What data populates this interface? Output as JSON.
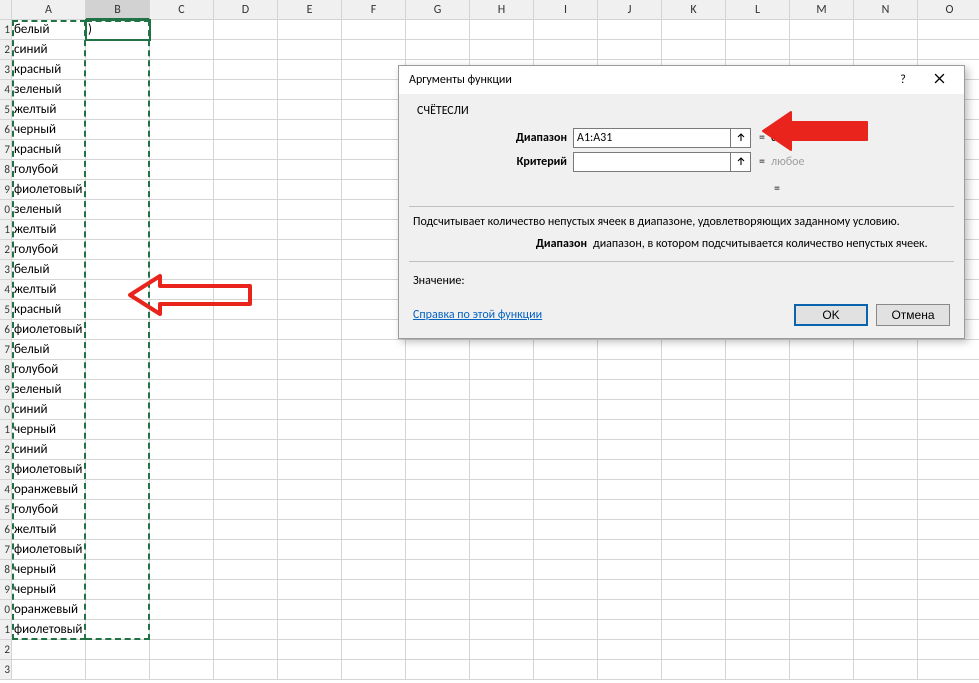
{
  "columns": [
    "A",
    "B",
    "C",
    "D",
    "E",
    "F",
    "G",
    "H",
    "I",
    "J",
    "K",
    "L",
    "M",
    "N",
    "O"
  ],
  "selectedColumn": "B",
  "rows": [
    {
      "n": "1",
      "a": "белый",
      "b": ")"
    },
    {
      "n": "2",
      "a": "синий"
    },
    {
      "n": "3",
      "a": "красный"
    },
    {
      "n": "4",
      "a": "зеленый"
    },
    {
      "n": "5",
      "a": "желтый"
    },
    {
      "n": "6",
      "a": "черный"
    },
    {
      "n": "7",
      "a": "красный"
    },
    {
      "n": "8",
      "a": "голубой"
    },
    {
      "n": "9",
      "a": "фиолетовый"
    },
    {
      "n": "0",
      "a": "зеленый"
    },
    {
      "n": "1",
      "a": "желтый"
    },
    {
      "n": "2",
      "a": "голубой"
    },
    {
      "n": "3",
      "a": "белый"
    },
    {
      "n": "4",
      "a": "желтый"
    },
    {
      "n": "5",
      "a": "красный"
    },
    {
      "n": "6",
      "a": "фиолетовый"
    },
    {
      "n": "7",
      "a": "белый"
    },
    {
      "n": "8",
      "a": "голубой"
    },
    {
      "n": "9",
      "a": "зеленый"
    },
    {
      "n": "0",
      "a": "синий"
    },
    {
      "n": "1",
      "a": "черный"
    },
    {
      "n": "2",
      "a": "синий"
    },
    {
      "n": "3",
      "a": "фиолетовый"
    },
    {
      "n": "4",
      "a": "оранжевый"
    },
    {
      "n": "5",
      "a": "голубой"
    },
    {
      "n": "6",
      "a": "желтый"
    },
    {
      "n": "7",
      "a": "фиолетовый"
    },
    {
      "n": "8",
      "a": "черный"
    },
    {
      "n": "9",
      "a": "черный"
    },
    {
      "n": "0",
      "a": "оранжевый"
    },
    {
      "n": "1",
      "a": "фиолетовый"
    },
    {
      "n": "2",
      "a": ""
    },
    {
      "n": "3",
      "a": ""
    }
  ],
  "dialog": {
    "title": "Аргументы функции",
    "funcName": "СЧЁТЕСЛИ",
    "arg1": {
      "label": "Диапазон",
      "value": "A1:A31",
      "result": "сный\":\"зелен..."
    },
    "arg2": {
      "label": "Критерий",
      "value": "",
      "result": "любое"
    },
    "eq": "=",
    "eqResult": "=",
    "desc": "Подсчитывает количество непустых ячеек в диапазоне, удовлетворяющих заданному условию.",
    "argDescLabel": "Диапазон",
    "argDescText": "диапазон, в котором подсчитывается количество непустых ячеек.",
    "valueLabel": "Значение:",
    "helpLink": "Справка по этой функции",
    "okLabel": "OK",
    "cancelLabel": "Отмена"
  }
}
